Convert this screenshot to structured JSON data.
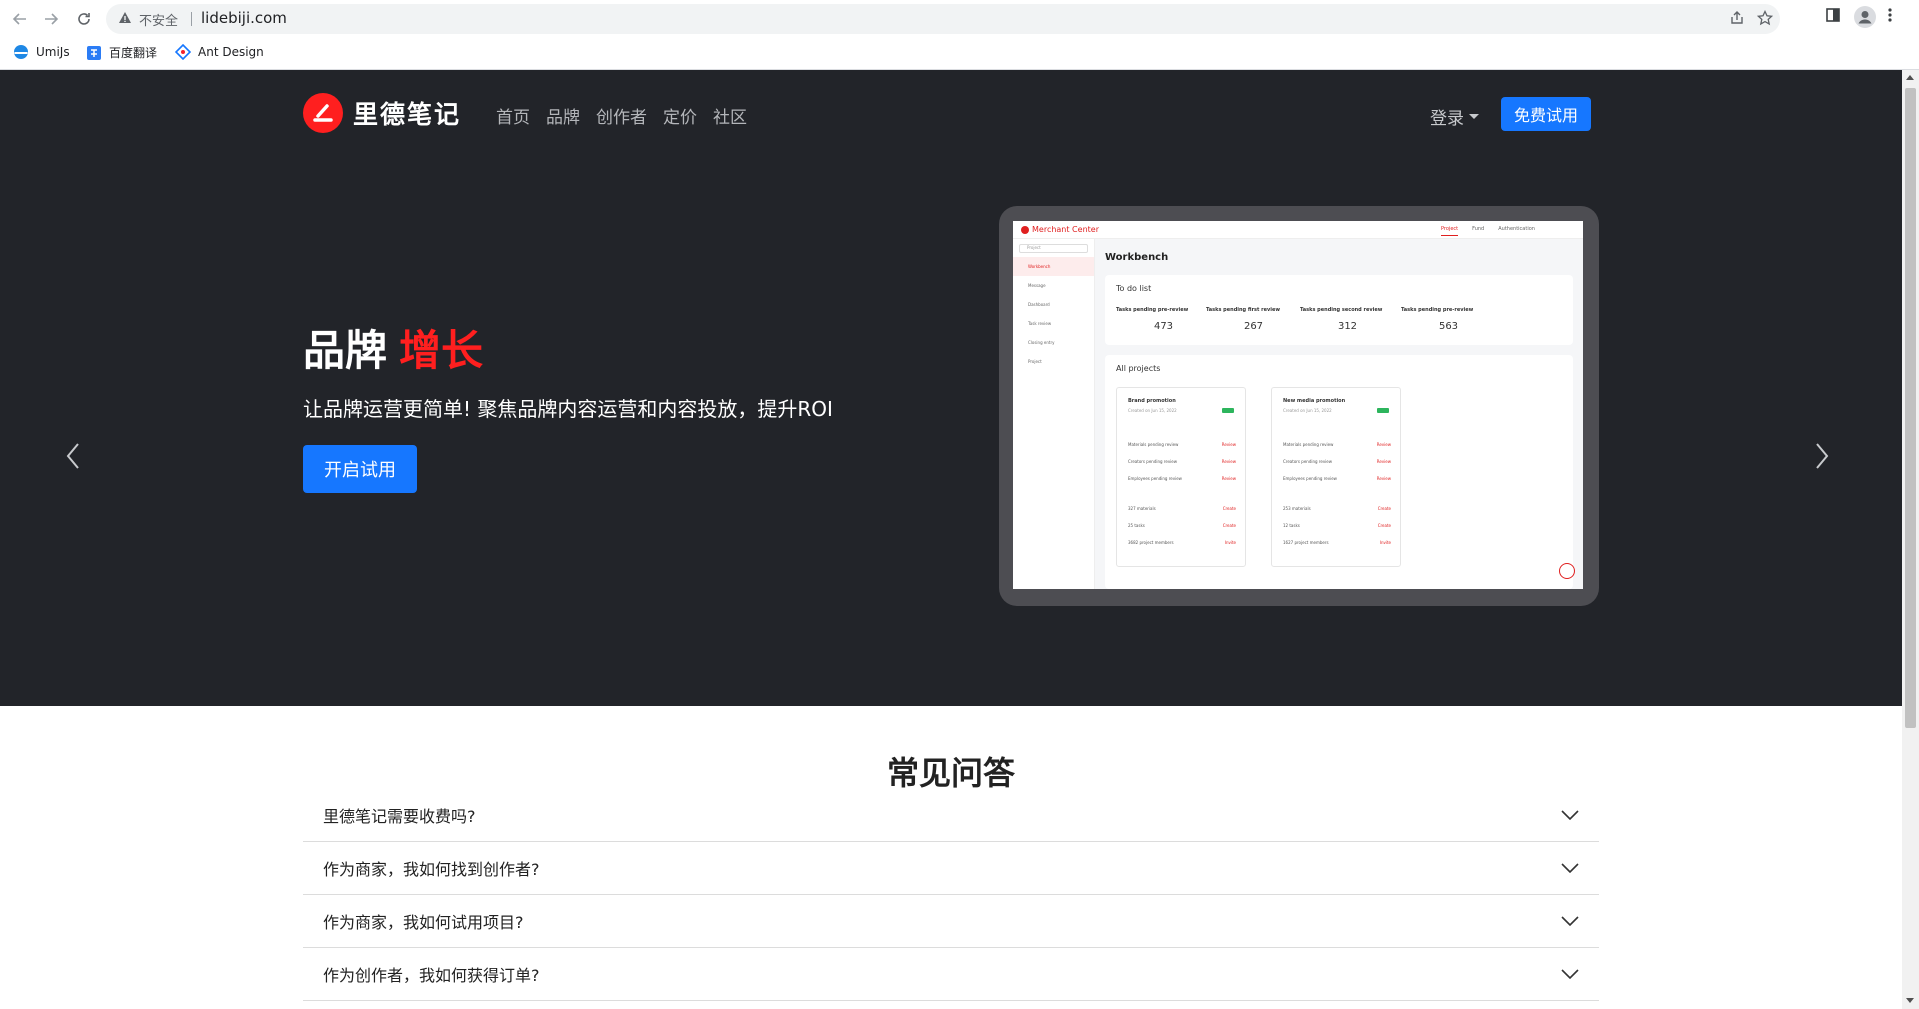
{
  "browser": {
    "insecure_label": "不安全",
    "url": "lidebiji.com",
    "bookmarks": [
      {
        "label": "UmiJs",
        "icon": "umijs-icon"
      },
      {
        "label": "百度翻译",
        "icon": "baidu-translate-icon"
      },
      {
        "label": "Ant Design",
        "icon": "ant-design-icon"
      }
    ]
  },
  "header": {
    "logo_text": "里德笔记",
    "nav": [
      "首页",
      "品牌",
      "创作者",
      "定价",
      "社区"
    ],
    "login_label": "登录",
    "trial_label": "免费试用"
  },
  "hero": {
    "title": "品牌",
    "title_accent": "增长",
    "subtitle": "让品牌运营更简单! 聚焦品牌内容运营和内容投放，提升ROI",
    "cta": "开启试用",
    "accent_color": "#ff1f1f",
    "button_color": "#1677ff",
    "bg_color": "#222429"
  },
  "mockup": {
    "brand": "Merchant Center",
    "tabs": [
      "Project",
      "Fund",
      "Authentication"
    ],
    "search_placeholder": "Project",
    "sidebar": [
      "Workbench",
      "Message",
      "Dashboard",
      "Task review",
      "Closing entry",
      "Project"
    ],
    "page_title": "Workbench",
    "todo_title": "To do list",
    "stats": [
      {
        "label": "Tasks pending pre-review",
        "value": "473"
      },
      {
        "label": "Tasks pending first review",
        "value": "267"
      },
      {
        "label": "Tasks pending second review",
        "value": "312"
      },
      {
        "label": "Tasks pending pre-review",
        "value": "563"
      }
    ],
    "projects_title": "All projects",
    "projects": [
      {
        "title": "Brand promotion",
        "date": "Created on Jun 15, 2022",
        "rows": [
          {
            "label": "Materials pending review",
            "action": "Review"
          },
          {
            "label": "Creators pending review",
            "action": "Review"
          },
          {
            "label": "Employees pending review",
            "action": "Review"
          },
          {
            "label": "327 materials",
            "action": "Create"
          },
          {
            "label": "25 tasks",
            "action": "Create"
          },
          {
            "label": "3682 project members",
            "action": "Invite"
          }
        ]
      },
      {
        "title": "New media promotion",
        "date": "Created on Jun 15, 2022",
        "rows": [
          {
            "label": "Materials pending review",
            "action": "Review"
          },
          {
            "label": "Creators pending review",
            "action": "Review"
          },
          {
            "label": "Employees pending review",
            "action": "Review"
          },
          {
            "label": "253 materials",
            "action": "Create"
          },
          {
            "label": "12 tasks",
            "action": "Create"
          },
          {
            "label": "1627 project members",
            "action": "Invite"
          }
        ]
      }
    ]
  },
  "faq": {
    "title": "常见问答",
    "items": [
      "里德笔记需要收费吗?",
      "作为商家，我如何找到创作者?",
      "作为商家，我如何试用项目?",
      "作为创作者，我如何获得订单?"
    ]
  }
}
